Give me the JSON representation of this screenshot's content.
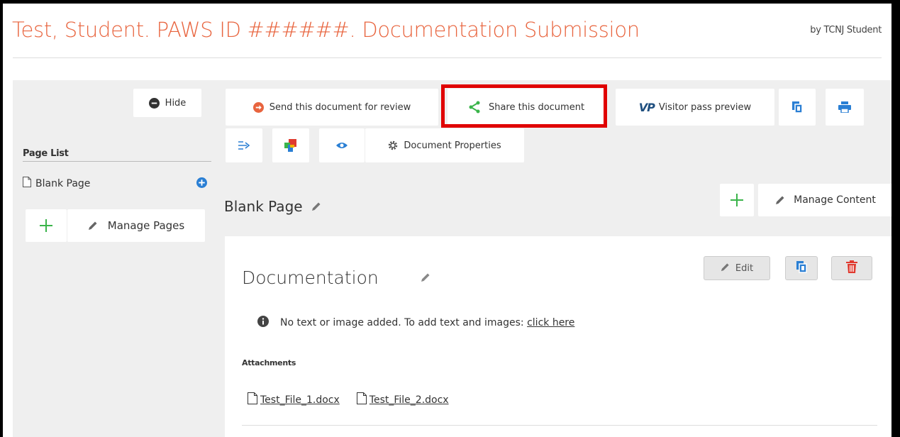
{
  "header": {
    "title": "Test, Student. PAWS ID ######. Documentation Submission",
    "byline": "by TCNJ Student"
  },
  "sidebar": {
    "hide_label": "Hide",
    "page_list_title": "Page List",
    "pages": [
      {
        "label": "Blank Page"
      }
    ],
    "manage_pages_label": "Manage Pages"
  },
  "toolbar": {
    "send_review_label": "Send this document for review",
    "share_label": "Share this document",
    "visitor_pass_label": "Visitor pass preview",
    "visitor_pass_logo": "VP",
    "document_properties_label": "Document Properties"
  },
  "page": {
    "title": "Blank Page",
    "manage_content_label": "Manage Content"
  },
  "section": {
    "title": "Documentation",
    "edit_label": "Edit",
    "info_text": "No text or image added. To add text and images:",
    "info_link": "click here",
    "attachments_label": "Attachments",
    "attachments": [
      {
        "name": "Test_File_1.docx"
      },
      {
        "name": "Test_File_2.docx"
      }
    ]
  },
  "colors": {
    "title": "#e8643e",
    "highlight": "#e00000",
    "green": "#3ab44a",
    "blue": "#2a7fd4",
    "red": "#e03a2f",
    "orange": "#e8643e"
  },
  "icons": [
    "minus-circle-icon",
    "arrow-right-circle-icon",
    "share-icon",
    "visitor-pass-icon",
    "copy-icon",
    "print-icon",
    "export-icon",
    "color-blocks-icon",
    "eye-icon",
    "gear-icon",
    "document-icon",
    "plus-circle-icon",
    "plus-icon",
    "pencil-icon",
    "info-icon",
    "trash-icon"
  ]
}
